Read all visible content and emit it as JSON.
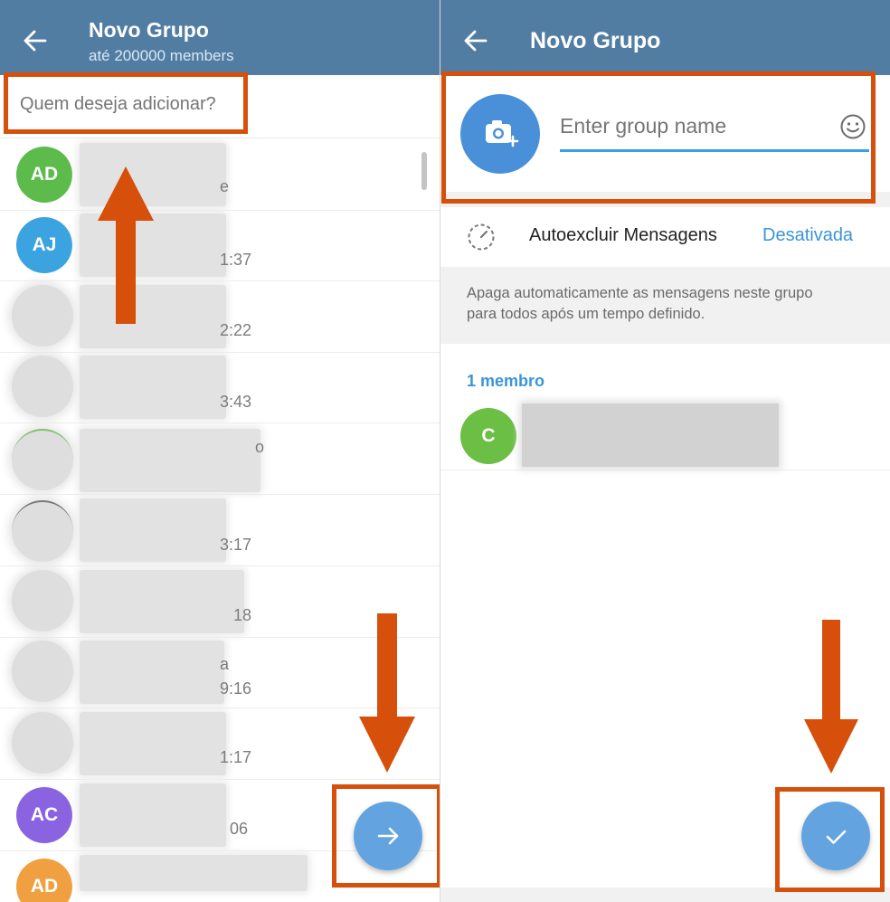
{
  "left": {
    "header": {
      "title": "Novo Grupo",
      "subtitle": "até 200000 members"
    },
    "search": {
      "placeholder": "Quem deseja adicionar?"
    },
    "contacts": [
      {
        "initials": "AD",
        "color": "#5cbb4a",
        "trail": "e"
      },
      {
        "initials": "AJ",
        "color": "#3aa3e0",
        "trail": "1:37"
      },
      {
        "initials": "",
        "color": "",
        "trail": "2:22"
      },
      {
        "initials": "",
        "color": "",
        "trail": "3:43"
      },
      {
        "initials": "",
        "color": "",
        "trail": "o"
      },
      {
        "initials": "",
        "color": "",
        "trail": "3:17"
      },
      {
        "initials": "",
        "color": "",
        "trail": "18"
      },
      {
        "initials": "",
        "color": "",
        "trail": "a\n9:16"
      },
      {
        "initials": "",
        "color": "",
        "trail": "1:17"
      },
      {
        "initials": "AC",
        "color": "#8a63e0",
        "trail": "06"
      },
      {
        "initials": "AD",
        "color": "#f0a040",
        "trail": ""
      }
    ],
    "fab_icon": "arrow-right-icon"
  },
  "right": {
    "header": {
      "title": "Novo Grupo"
    },
    "group_name": {
      "placeholder": "Enter group name"
    },
    "auto_delete": {
      "label": "Autoexcluir Mensagens",
      "value": "Desativada"
    },
    "info": "Apaga automaticamente as mensagens neste grupo para todos após um tempo definido.",
    "members_header": "1 membro",
    "members": [
      {
        "initials": "C",
        "color": "#6abf44"
      }
    ],
    "fab_icon": "checkmark-icon"
  },
  "colors": {
    "header": "#527da3",
    "accent": "#3a95d8",
    "fab": "#62a3e0",
    "annotation": "#d64f0b"
  }
}
